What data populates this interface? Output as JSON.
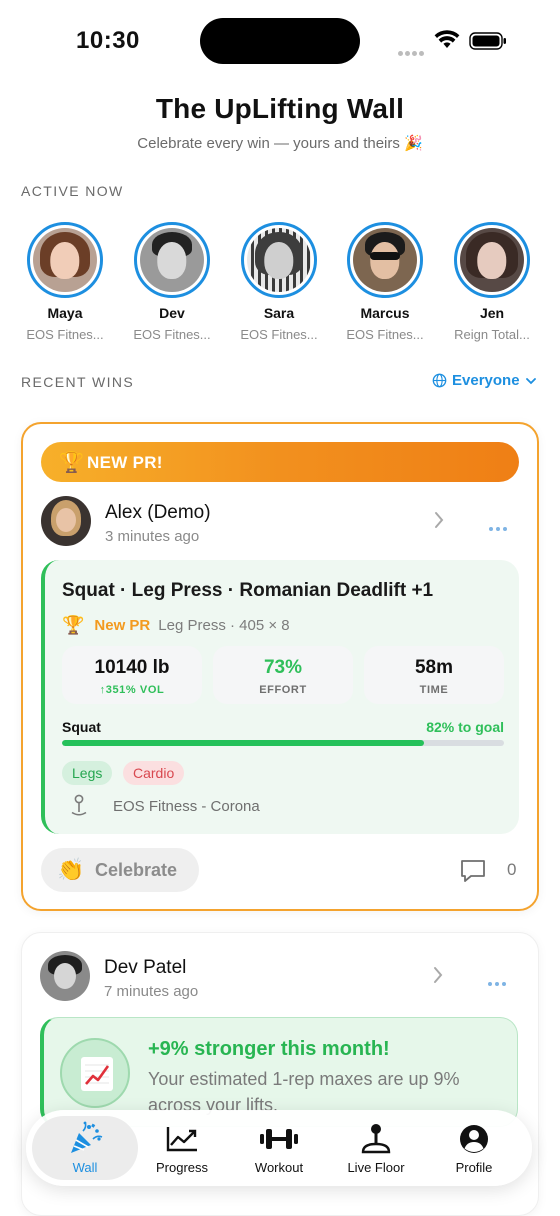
{
  "status_bar": {
    "time": "10:30"
  },
  "header": {
    "title": "The UpLifting Wall",
    "subtitle": "Celebrate every win — yours and theirs 🎉"
  },
  "active_now": {
    "label": "ACTIVE NOW",
    "people": [
      {
        "name": "Maya",
        "gym": "EOS Fitnes..."
      },
      {
        "name": "Dev",
        "gym": "EOS Fitnes..."
      },
      {
        "name": "Sara",
        "gym": "EOS Fitnes..."
      },
      {
        "name": "Marcus",
        "gym": "EOS Fitnes..."
      },
      {
        "name": "Jen",
        "gym": "Reign Total..."
      }
    ]
  },
  "recent_wins": {
    "label": "RECENT WINS",
    "filter": "Everyone"
  },
  "post1": {
    "badge": "NEW PR!",
    "user": "Alex (Demo)",
    "time": "3 minutes ago",
    "workout_title": "Squat · Leg Press · Romanian Deadlift +1",
    "pr_tag": "New PR",
    "pr_detail": "Leg Press · 405 × 8",
    "stats": [
      {
        "value": "10140 lb",
        "sub": "↑351% VOL",
        "color": "#1a1a1a",
        "sub_color": "#2fbf5a"
      },
      {
        "value": "73%",
        "sub": "EFFORT",
        "color": "#2fbf5a",
        "sub_color": "#6f6f6f"
      },
      {
        "value": "58m",
        "sub": "TIME",
        "color": "#1a1a1a",
        "sub_color": "#6f6f6f"
      }
    ],
    "goal_label": "Squat",
    "goal_text": "82% to goal",
    "goal_progress": 0.82,
    "tags": [
      "Legs",
      "Cardio"
    ],
    "location": "EOS Fitness - Corona",
    "celebrate": "Celebrate",
    "comment_count": "0"
  },
  "post2": {
    "user": "Dev Patel",
    "time": "7 minutes ago",
    "insight_title": "+9% stronger this month!",
    "insight_text": "Your estimated 1-rep maxes are up 9% across your lifts."
  },
  "tabbar": {
    "tabs": [
      {
        "label": "Wall",
        "icon": "party-popper-icon"
      },
      {
        "label": "Progress",
        "icon": "trend-chart-icon"
      },
      {
        "label": "Workout",
        "icon": "dumbbell-icon"
      },
      {
        "label": "Live Floor",
        "icon": "joystick-pin-icon"
      },
      {
        "label": "Profile",
        "icon": "person-icon"
      }
    ],
    "active": "Wall"
  },
  "colors": {
    "accent_blue": "#1d8fe0",
    "pr_orange": "#f39a1f",
    "success_green": "#2fbf5a",
    "cardio_red": "#d8484f"
  }
}
